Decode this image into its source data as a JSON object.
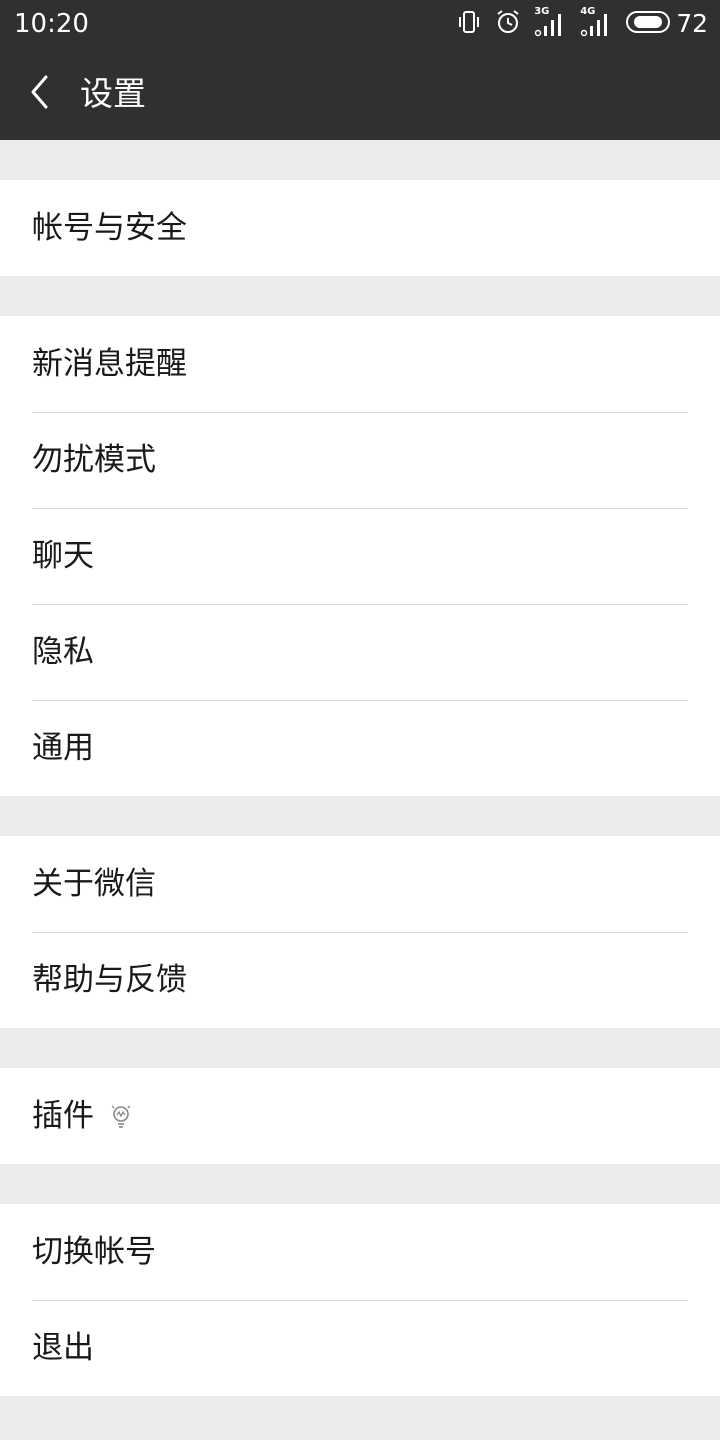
{
  "status_bar": {
    "time": "10:20",
    "network_1": "3G",
    "network_2": "4G",
    "battery_level": "72",
    "icons": [
      "vibrate-icon",
      "alarm-icon",
      "signal-3g-icon",
      "signal-4g-icon",
      "battery-icon"
    ]
  },
  "header": {
    "back_icon": "chevron-left-icon",
    "title": "设置"
  },
  "groups": [
    {
      "items": [
        {
          "label": "帐号与安全"
        }
      ]
    },
    {
      "items": [
        {
          "label": "新消息提醒"
        },
        {
          "label": "勿扰模式"
        },
        {
          "label": "聊天"
        },
        {
          "label": "隐私"
        },
        {
          "label": "通用"
        }
      ]
    },
    {
      "items": [
        {
          "label": "关于微信"
        },
        {
          "label": "帮助与反馈"
        }
      ]
    },
    {
      "items": [
        {
          "label": "插件",
          "icon": "lightbulb-icon"
        }
      ]
    },
    {
      "items": [
        {
          "label": "切换帐号"
        },
        {
          "label": "退出"
        }
      ]
    }
  ],
  "colors": {
    "header_bg": "#303030",
    "page_bg": "#ebebeb",
    "row_bg": "#ffffff",
    "divider": "#d9d9d9",
    "text": "#1a1a1a"
  }
}
